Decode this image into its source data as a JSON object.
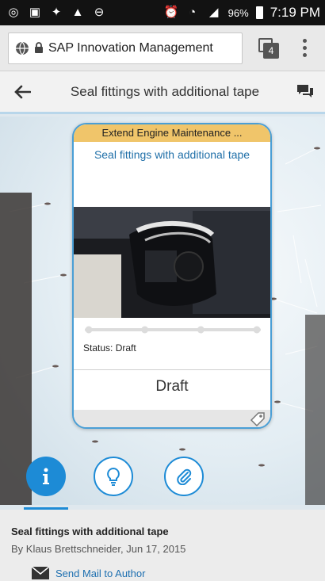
{
  "status_bar": {
    "battery_percent": "96%",
    "time": "7:19 PM"
  },
  "browser": {
    "url_title": "SAP Innovation Management",
    "tab_count": "4"
  },
  "header": {
    "title": "Seal fittings with additional tape"
  },
  "card": {
    "campaign": "Extend Engine Maintenance ...",
    "title": "Seal fittings with additional tape",
    "status_label": "Status: Draft",
    "phase": "Draft",
    "progress_steps": 4,
    "progress_current": 0
  },
  "actions": [
    {
      "name": "info",
      "icon": "info-icon",
      "active": true
    },
    {
      "name": "ideas",
      "icon": "lightbulb-icon",
      "active": false
    },
    {
      "name": "attachments",
      "icon": "paperclip-icon",
      "active": false
    }
  ],
  "details": {
    "title": "Seal fittings with additional tape",
    "author_line": "By Klaus Brettschneider, Jun 17, 2015",
    "mail_link": "Send Mail to Author"
  },
  "colors": {
    "accent": "#1d8bd6",
    "campaign_banner": "#f0c56a",
    "title_blue": "#1f6fa8"
  }
}
